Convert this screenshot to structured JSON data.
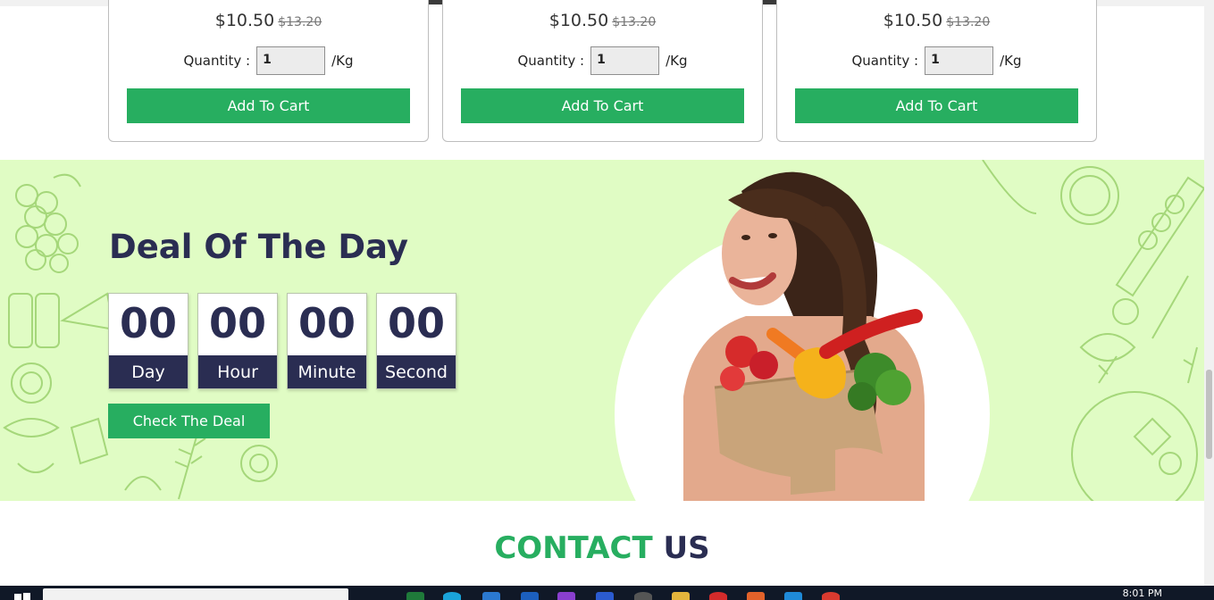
{
  "products": [
    {
      "price": "$10.50",
      "old_price": "$13.20",
      "qty_label": "Quantity :",
      "qty_value": "1",
      "unit": "/Kg",
      "button": "Add To Cart"
    },
    {
      "price": "$10.50",
      "old_price": "$13.20",
      "qty_label": "Quantity :",
      "qty_value": "1",
      "unit": "/Kg",
      "button": "Add To Cart"
    },
    {
      "price": "$10.50",
      "old_price": "$13.20",
      "qty_label": "Quantity :",
      "qty_value": "1",
      "unit": "/Kg",
      "button": "Add To Cart"
    }
  ],
  "deal": {
    "title": "Deal Of The Day",
    "timer": [
      {
        "value": "00",
        "label": "Day"
      },
      {
        "value": "00",
        "label": "Hour"
      },
      {
        "value": "00",
        "label": "Minute"
      },
      {
        "value": "00",
        "label": "Second"
      }
    ],
    "button": "Check The Deal"
  },
  "contact": {
    "word1": "CONTACT",
    "word2": "US"
  },
  "taskbar": {
    "time": "8:01 PM"
  },
  "colors": {
    "green": "#27ae60",
    "navy": "#2a2d52",
    "deal_bg": "#e0fcc4",
    "doodle": "#a5d77a"
  }
}
